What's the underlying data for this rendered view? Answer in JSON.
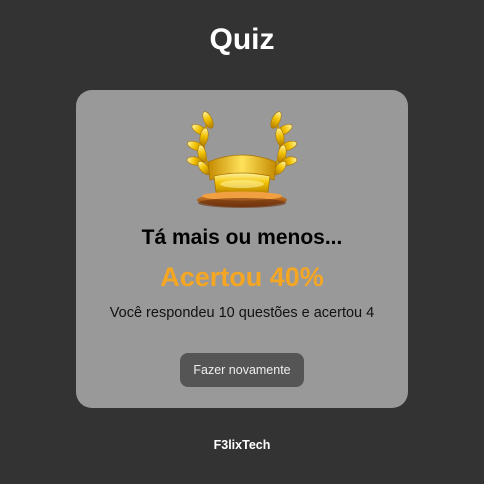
{
  "header": {
    "title": "Quiz"
  },
  "result": {
    "icon": "trophy-laurel-icon",
    "headline": "Tá mais ou menos...",
    "score_text": "Acertou 40%",
    "score_percent": 40,
    "summary": "Você respondeu 10 questões e acertou 4",
    "answered": 10,
    "correct": 4,
    "retry_label": "Fazer novamente"
  },
  "footer": {
    "brand": "F3lixTech"
  },
  "colors": {
    "background": "#333333",
    "card": "#999999",
    "score": "#f5a623",
    "button": "#555555"
  }
}
